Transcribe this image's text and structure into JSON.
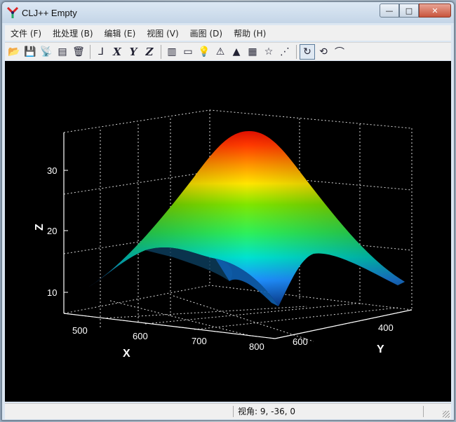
{
  "window": {
    "title": "CLJ++ Empty",
    "buttons": {
      "minimize": "—",
      "maximize": "□",
      "close": "✕"
    }
  },
  "menu": [
    {
      "label": "文件 (F)"
    },
    {
      "label": "批处理 (B)"
    },
    {
      "label": "编辑 (E)"
    },
    {
      "label": "视图 (V)"
    },
    {
      "label": "画图 (D)"
    },
    {
      "label": "帮助 (H)"
    }
  ],
  "toolbar": {
    "buttons": [
      {
        "name": "open-icon",
        "glyph": "📂"
      },
      {
        "name": "save-icon",
        "glyph": "💾"
      },
      {
        "name": "antenna-icon",
        "glyph": "📡"
      },
      {
        "name": "document-icon",
        "glyph": "▤"
      },
      {
        "name": "trash-icon",
        "glyph": "🗑"
      }
    ],
    "axis_buttons": [
      {
        "name": "axes-icon",
        "glyph": "⅃"
      },
      {
        "name": "x-axis-icon",
        "glyph": "X"
      },
      {
        "name": "y-axis-icon",
        "glyph": "Y"
      },
      {
        "name": "z-axis-icon",
        "glyph": "Z"
      }
    ],
    "tool_buttons": [
      {
        "name": "colorbar-icon",
        "glyph": "▥"
      },
      {
        "name": "label-icon",
        "glyph": "▭"
      },
      {
        "name": "light-icon",
        "glyph": "💡"
      },
      {
        "name": "wireframe-icon",
        "glyph": "⚠"
      },
      {
        "name": "surface-icon",
        "glyph": "▲"
      },
      {
        "name": "colormap-icon",
        "glyph": "▦"
      },
      {
        "name": "star-icon",
        "glyph": "☆"
      },
      {
        "name": "scatter-icon",
        "glyph": "⋰"
      }
    ],
    "view_buttons": [
      {
        "name": "rotate-icon",
        "glyph": "↻"
      },
      {
        "name": "cube-rotate-icon",
        "glyph": "⟲"
      },
      {
        "name": "arc-icon",
        "glyph": "⌒"
      }
    ]
  },
  "status": {
    "text": "视角: 9, -36, 0"
  },
  "chart_data": {
    "type": "surface",
    "title": "",
    "xlabel": "X",
    "ylabel": "Y",
    "zlabel": "Z",
    "x_ticks": [
      "500",
      "600",
      "700",
      "800"
    ],
    "y_ticks": [
      "400",
      "600"
    ],
    "z_ticks": [
      "10",
      "20",
      "30"
    ],
    "zlim": [
      7,
      36
    ],
    "view_angle": [
      9,
      -36,
      0
    ],
    "colormap": [
      "#0a2a6a",
      "#1f8fff",
      "#00e6ff",
      "#3dff5a",
      "#7fe600",
      "#ffe600",
      "#ff8a00",
      "#e11000"
    ],
    "peak_z": 35
  }
}
